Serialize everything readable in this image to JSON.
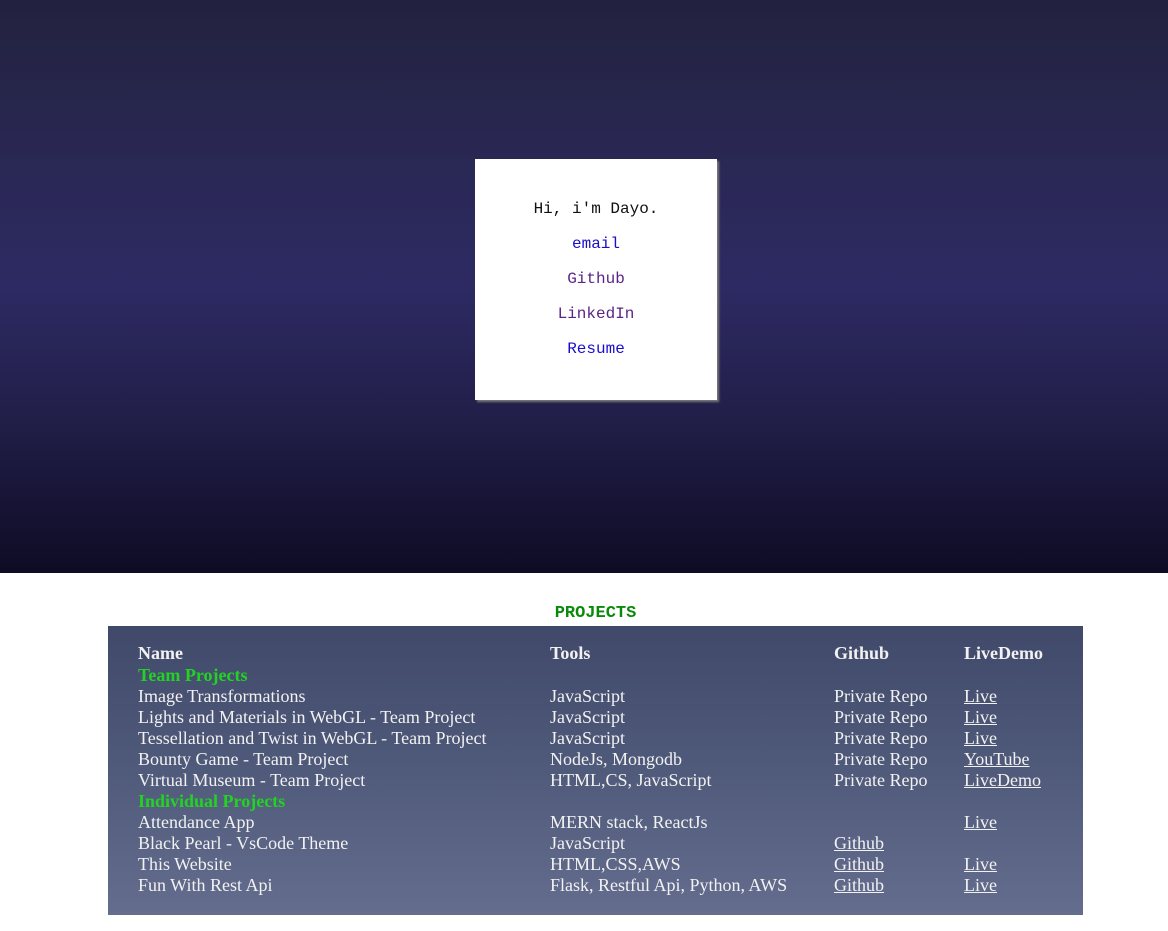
{
  "hero": {
    "greeting": "Hi, i'm Dayo.",
    "links": {
      "email": "email",
      "github": "Github",
      "linkedin": "LinkedIn",
      "resume": "Resume"
    }
  },
  "projects": {
    "heading": "PROJECTS",
    "headers": {
      "name": "Name",
      "tools": "Tools",
      "github": "Github",
      "livedemo": "LiveDemo"
    },
    "team": {
      "label": "Team Projects",
      "rows": [
        {
          "name": "Image Transformations",
          "tools": "JavaScript",
          "github": "Private Repo",
          "live": "Live"
        },
        {
          "name": "Lights and Materials in WebGL - Team Project",
          "tools": "JavaScript",
          "github": "Private Repo",
          "live": "Live"
        },
        {
          "name": "Tessellation and Twist in WebGL - Team Project",
          "tools": "JavaScript",
          "github": "Private Repo",
          "live": "Live"
        },
        {
          "name": "Bounty Game - Team Project",
          "tools": "NodeJs, Mongodb",
          "github": "Private Repo",
          "live": "YouTube"
        },
        {
          "name": "Virtual Museum - Team Project",
          "tools": "HTML,CS, JavaScript",
          "github": "Private Repo",
          "live": "LiveDemo"
        }
      ]
    },
    "individual": {
      "label": "Individual Projects",
      "rows": [
        {
          "name": "Attendance App",
          "tools": "MERN stack, ReactJs",
          "github": "",
          "live": "Live"
        },
        {
          "name": "Black Pearl - VsCode Theme",
          "tools": "JavaScript",
          "github": "Github",
          "live": ""
        },
        {
          "name": "This Website",
          "tools": "HTML,CSS,AWS",
          "github": "Github",
          "live": "Live"
        },
        {
          "name": "Fun With Rest Api",
          "tools": "Flask, Restful Api, Python, AWS",
          "github": "Github",
          "live": "Live"
        }
      ]
    }
  },
  "colors": {
    "group_label": "#22d322",
    "projects_heading": "#0a8a0a",
    "link_blue": "#1a0dcc",
    "link_visited": "#5b2486"
  }
}
